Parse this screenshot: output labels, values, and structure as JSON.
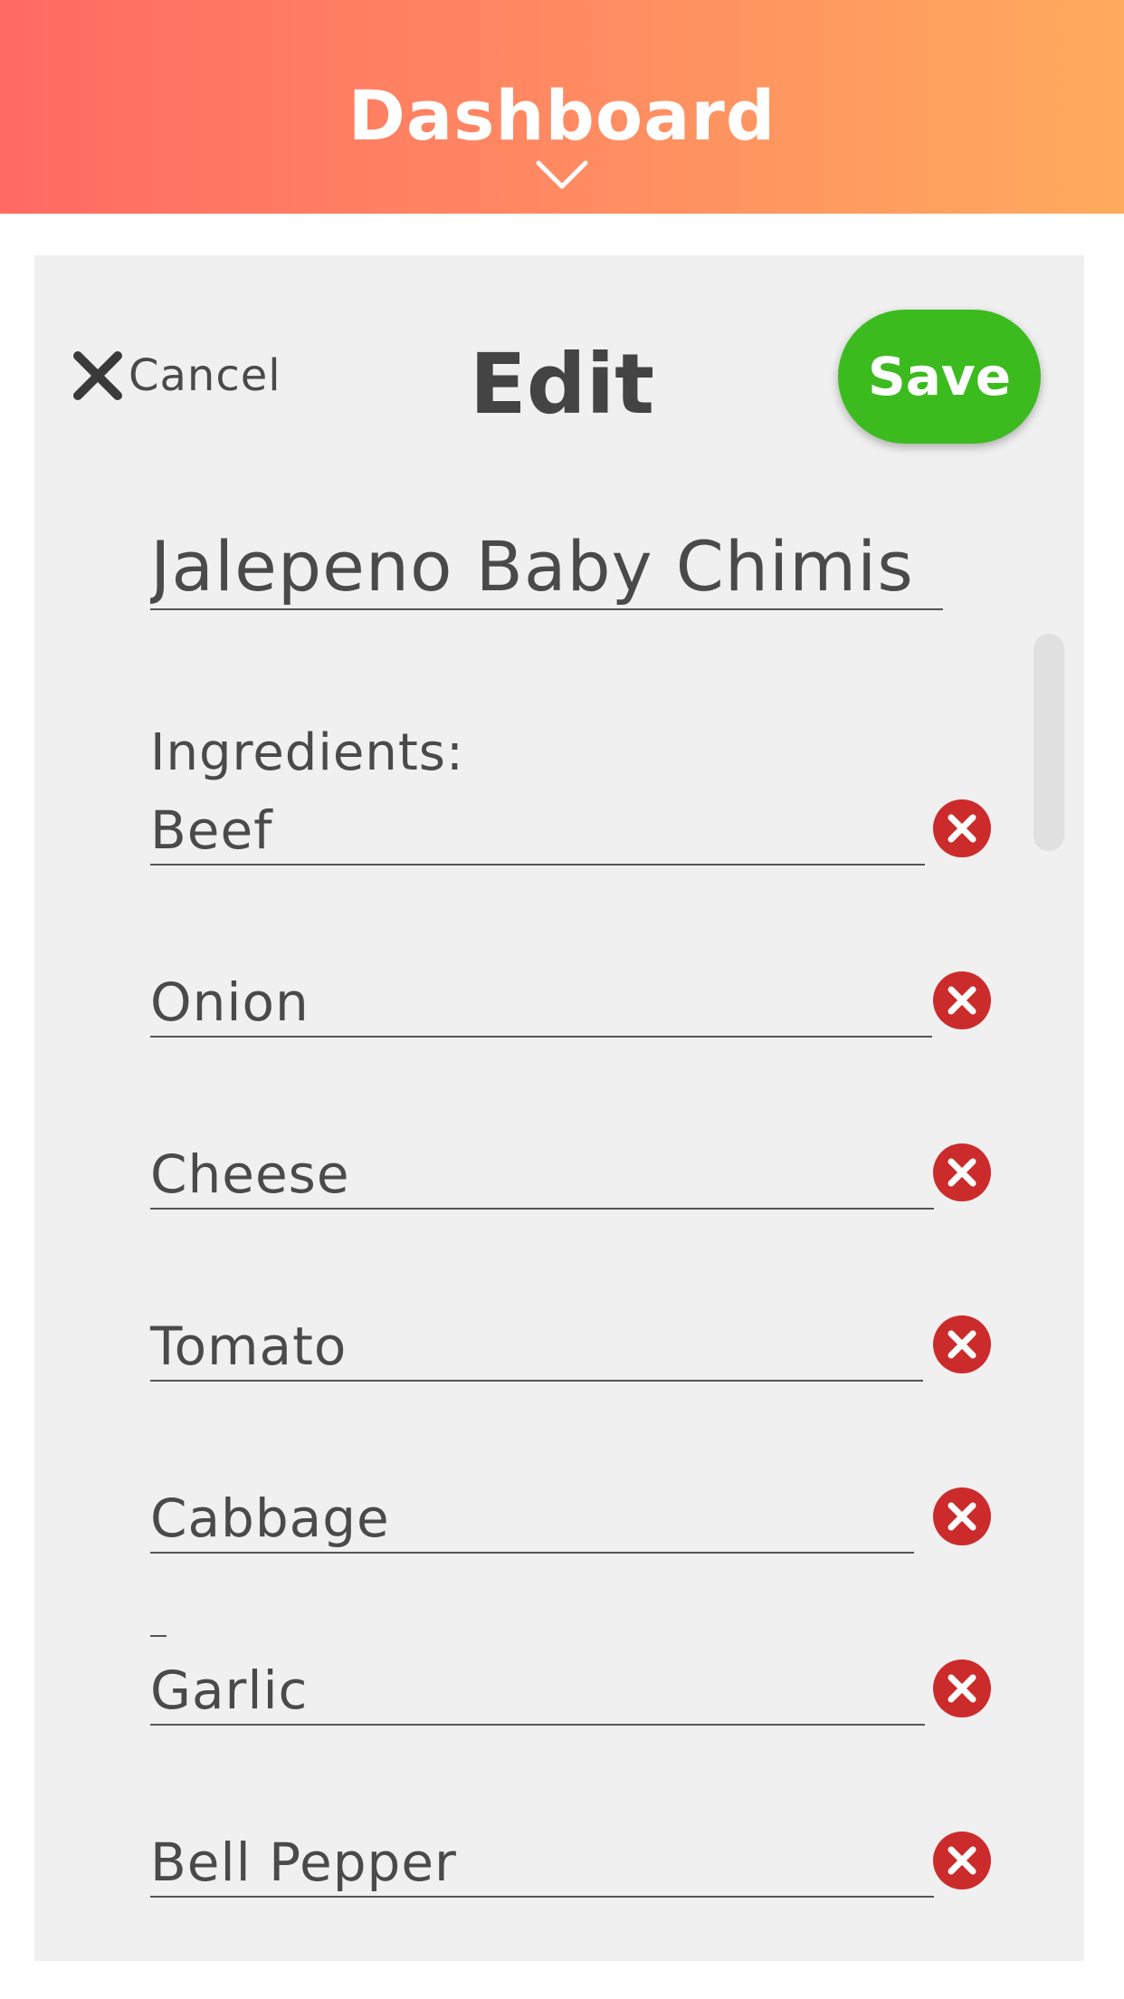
{
  "header": {
    "title": "Dashboard",
    "chevron_icon": "chevron-down-icon",
    "gradient_colors": [
      "#ff6a63",
      "#ffab5d"
    ]
  },
  "edit_form": {
    "cancel_icon": "close-icon",
    "cancel_label": "Cancel",
    "title": "Edit",
    "save_label": "Save",
    "save_color": "#3cbb1e",
    "recipe_name": "Jalepeno Baby Chimis",
    "ingredients_label": "Ingredients:",
    "remove_icon": "remove-circle-icon",
    "remove_color": "#cc2b2b",
    "ingredients": [
      {
        "name": "Beef"
      },
      {
        "name": "Onion"
      },
      {
        "name": "Cheese"
      },
      {
        "name": "Tomato"
      },
      {
        "name": "Cabbage"
      },
      {
        "name": "Garlic"
      },
      {
        "name": "Bell Pepper"
      }
    ]
  }
}
